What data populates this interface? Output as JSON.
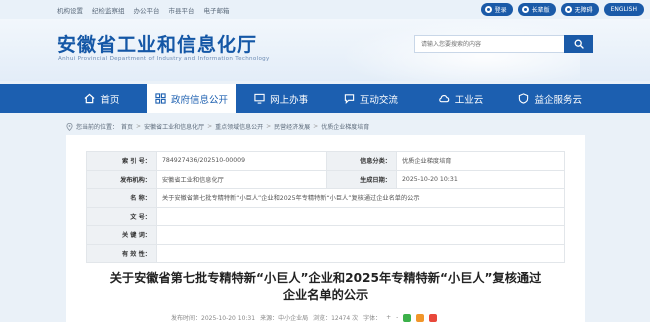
{
  "topbar": {
    "links": [
      "机构设置",
      "纪检监察组",
      "办公平台",
      "市县平台",
      "电子邮箱"
    ],
    "buttons": [
      {
        "label": "登录",
        "icon": "user-icon"
      },
      {
        "label": "长辈版",
        "icon": "elder-icon"
      },
      {
        "label": "无障碍",
        "icon": "accessibility-icon"
      },
      {
        "label": "ENGLISH"
      }
    ]
  },
  "header": {
    "title": "安徽省工业和信息化厅",
    "subtitle": "Anhui Provincial Department of Industry and Information Technology",
    "search_placeholder": "请输入您要搜索的内容"
  },
  "nav": {
    "items": [
      {
        "label": "首页",
        "icon": "home-icon"
      },
      {
        "label": "政府信息公开",
        "icon": "grid-icon",
        "active": true
      },
      {
        "label": "网上办事",
        "icon": "monitor-icon"
      },
      {
        "label": "互动交流",
        "icon": "chat-icon"
      },
      {
        "label": "工业云",
        "icon": "cloud-icon"
      },
      {
        "label": "益企服务云",
        "icon": "shield-icon"
      }
    ]
  },
  "breadcrumb": {
    "prefix": "您当前的位置：",
    "items": [
      "首页",
      "安徽省工业和信息化厅",
      "重点领域信息公开",
      "民营经济发展",
      "优质企业梯度培育"
    ]
  },
  "meta": {
    "index_label": "索 引 号：",
    "index_value": "784927436/202510-00009",
    "category_label": "信息分类：",
    "category_value": "优质企业梯度培育",
    "publisher_label": "发布机构：",
    "publisher_value": "安徽省工业和信息化厅",
    "date_label": "生成日期：",
    "date_value": "2025-10-20 10:31",
    "name_label": "名 称：",
    "name_value": "关于安徽省第七批专精特新“小巨人”企业和2025年专精特新“小巨人”复核通过企业名单的公示",
    "docno_label": "文 号：",
    "docno_value": "",
    "keywords_label": "关 键 词：",
    "keywords_value": "",
    "validity_label": "有 效 性：",
    "validity_value": ""
  },
  "article": {
    "title_line1": "关于安徽省第七批专精特新“小巨人”企业和2025年专精特新“小巨人”复核通过",
    "title_line2": "企业名单的公示",
    "info_publish": "发布时间：2025-10-20 10:31",
    "info_source": "来源：中小企业局",
    "info_views": "浏览：12474 次",
    "info_font": "字体：",
    "font_plus": "+",
    "font_minus": "-"
  },
  "colors": {
    "brand": "#1c5fb0",
    "header_title": "#1457a6",
    "share_green": "#3cb14a",
    "share_orange": "#f1962a",
    "share_red": "#e8483b"
  }
}
